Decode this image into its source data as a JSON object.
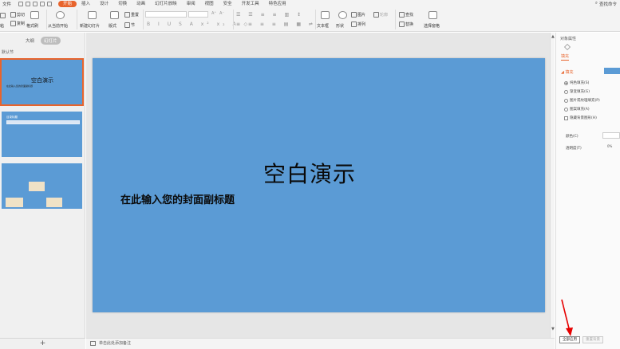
{
  "menubar": {
    "file_label": "文件",
    "tabs": [
      {
        "label": "开始",
        "active": true
      },
      {
        "label": "插入",
        "active": false
      },
      {
        "label": "设计",
        "active": false
      },
      {
        "label": "切换",
        "active": false
      },
      {
        "label": "动画",
        "active": false
      },
      {
        "label": "幻灯片放映",
        "active": false
      },
      {
        "label": "审阅",
        "active": false
      },
      {
        "label": "视图",
        "active": false
      },
      {
        "label": "安全",
        "active": false
      },
      {
        "label": "开发工具",
        "active": false
      },
      {
        "label": "特色应用",
        "active": false
      }
    ],
    "search_label": "查找命令"
  },
  "ribbon": {
    "cut": "剪切",
    "copy": "复制",
    "format_painter": "格式刷",
    "paste": "粘",
    "from_current": "从当前开始",
    "new_slide": "新建幻灯片",
    "layout": "版式",
    "reset": "重置",
    "section": "节",
    "textbox": "文本框",
    "shape": "形状",
    "picture": "图片",
    "arrange": "排列",
    "outline": "轮廓",
    "find": "查找",
    "replace": "替换",
    "select_pane": "选择窗格"
  },
  "left_panel": {
    "tab_outline": "大纲",
    "tab_slides": "幻灯片",
    "section_label": "默认节",
    "thumb1_title": "空白演示",
    "thumb1_sub": "在此输入您的封面副标题",
    "thumb2_title": "目录标题",
    "add_slide": "+"
  },
  "slide": {
    "title": "空白演示",
    "subtitle": "在此输入您的封面副标题"
  },
  "notes": {
    "placeholder": "单击此处添加备注"
  },
  "right_panel": {
    "title": "对象属性",
    "fill_tab": "填充",
    "fill_section": "填充",
    "options": [
      {
        "label": "纯色填充(S)",
        "type": "radio",
        "checked": true
      },
      {
        "label": "渐变填充(G)",
        "type": "radio",
        "checked": false
      },
      {
        "label": "图片或纹理填充(P)",
        "type": "radio",
        "checked": false
      },
      {
        "label": "图案填充(A)",
        "type": "radio",
        "checked": false
      },
      {
        "label": "隐藏背景图形(H)",
        "type": "checkbox",
        "checked": false
      }
    ],
    "color_label": "颜色(C)",
    "transparency_label": "透明度(T)",
    "transparency_value": "0%",
    "apply_all": "全部应用",
    "reset_background": "重置背景"
  },
  "colors": {
    "accent": "#e8642c",
    "slide_bg": "#5b9bd5",
    "arrow": "#e60000"
  }
}
